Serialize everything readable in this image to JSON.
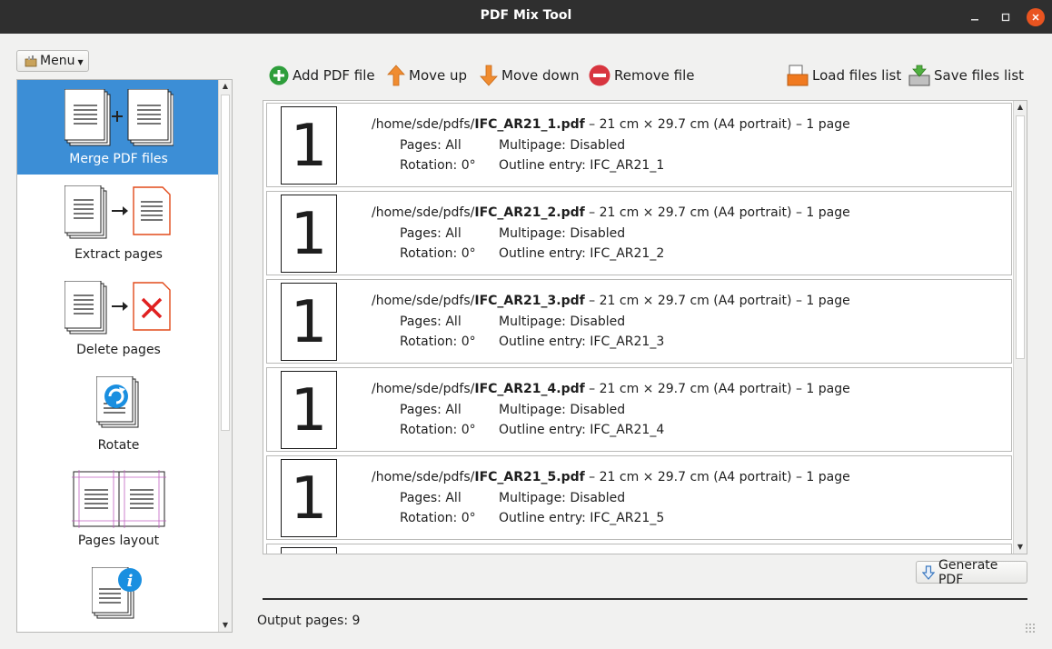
{
  "window": {
    "title": "PDF Mix Tool"
  },
  "menu": {
    "label": "Menu",
    "icon": "toolbox-icon"
  },
  "sidebar": {
    "items": [
      {
        "label": "Merge PDF files",
        "icon": "merge-icon",
        "active": true
      },
      {
        "label": "Extract pages",
        "icon": "extract-pages-icon"
      },
      {
        "label": "Delete pages",
        "icon": "delete-pages-icon"
      },
      {
        "label": "Rotate",
        "icon": "rotate-icon"
      },
      {
        "label": "Pages layout",
        "icon": "pages-layout-icon"
      },
      {
        "label": "",
        "icon": "info-icon"
      }
    ]
  },
  "toolbar": {
    "add_label": "Add PDF file",
    "move_up_label": "Move up",
    "move_down_label": "Move down",
    "remove_label": "Remove file",
    "load_label": "Load files list",
    "save_label": "Save files list"
  },
  "files": [
    {
      "thumb": "1",
      "dir": "/home/sde/pdfs/",
      "name": "IFC_AR21_1.pdf",
      "info": " – 21 cm × 29.7 cm (A4 portrait) – 1 page",
      "pages": "Pages: All",
      "multipage": "Multipage: Disabled",
      "rotation": "Rotation: 0°",
      "outline": "Outline entry: IFC_AR21_1"
    },
    {
      "thumb": "1",
      "dir": "/home/sde/pdfs/",
      "name": "IFC_AR21_2.pdf",
      "info": " – 21 cm × 29.7 cm (A4 portrait) – 1 page",
      "pages": "Pages: All",
      "multipage": "Multipage: Disabled",
      "rotation": "Rotation: 0°",
      "outline": "Outline entry: IFC_AR21_2"
    },
    {
      "thumb": "1",
      "dir": "/home/sde/pdfs/",
      "name": "IFC_AR21_3.pdf",
      "info": " – 21 cm × 29.7 cm (A4 portrait) – 1 page",
      "pages": "Pages: All",
      "multipage": "Multipage: Disabled",
      "rotation": "Rotation: 0°",
      "outline": "Outline entry: IFC_AR21_3"
    },
    {
      "thumb": "1",
      "dir": "/home/sde/pdfs/",
      "name": "IFC_AR21_4.pdf",
      "info": " – 21 cm × 29.7 cm (A4 portrait) – 1 page",
      "pages": "Pages: All",
      "multipage": "Multipage: Disabled",
      "rotation": "Rotation: 0°",
      "outline": "Outline entry: IFC_AR21_4"
    },
    {
      "thumb": "1",
      "dir": "/home/sde/pdfs/",
      "name": "IFC_AR21_5.pdf",
      "info": " – 21 cm × 29.7 cm (A4 portrait) – 1 page",
      "pages": "Pages: All",
      "multipage": "Multipage: Disabled",
      "rotation": "Rotation: 0°",
      "outline": "Outline entry: IFC_AR21_5"
    }
  ],
  "generate": {
    "label": "Generate PDF"
  },
  "status": {
    "output_pages": "Output pages: 9"
  },
  "colors": {
    "accent": "#3c8ed6",
    "titlebar": "#2f2f2f",
    "close": "#e95420",
    "add": "#2e9e3b",
    "remove": "#d8353f",
    "arrow": "#f08c30"
  }
}
